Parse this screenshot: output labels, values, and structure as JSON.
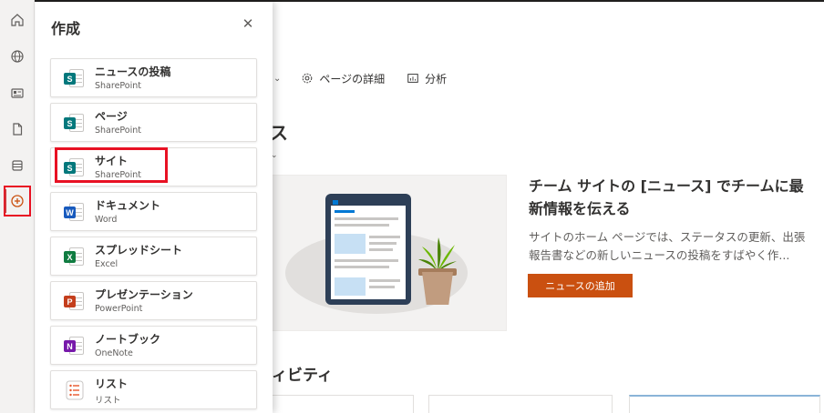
{
  "panel": {
    "title": "作成",
    "items": [
      {
        "title": "ニュースの投稿",
        "subtitle": "SharePoint",
        "app": "sharepoint",
        "letter": "S",
        "color": "#03787c"
      },
      {
        "title": "ページ",
        "subtitle": "SharePoint",
        "app": "sharepoint",
        "letter": "S",
        "color": "#03787c"
      },
      {
        "title": "サイト",
        "subtitle": "SharePoint",
        "app": "sharepoint",
        "letter": "S",
        "color": "#03787c"
      },
      {
        "title": "ドキュメント",
        "subtitle": "Word",
        "app": "word",
        "letter": "W",
        "color": "#185abd"
      },
      {
        "title": "スプレッドシート",
        "subtitle": "Excel",
        "app": "excel",
        "letter": "X",
        "color": "#107c41"
      },
      {
        "title": "プレゼンテーション",
        "subtitle": "PowerPoint",
        "app": "powerpoint",
        "letter": "P",
        "color": "#c43e1c"
      },
      {
        "title": "ノートブック",
        "subtitle": "OneNote",
        "app": "onenote",
        "letter": "N",
        "color": "#7719aa"
      },
      {
        "title": "リスト",
        "subtitle": "リスト",
        "app": "lists",
        "letter": "",
        "color": "#e8562b"
      }
    ]
  },
  "rail": {
    "items": [
      "home-icon",
      "globe-icon",
      "news-icon",
      "file-icon",
      "database-icon",
      "add-circle-icon"
    ],
    "active": "add-circle-icon"
  },
  "commandbar": {
    "page_details": "ページの詳細",
    "analytics": "分析"
  },
  "news": {
    "title_fragment": "ス",
    "promo_title": "チーム サイトの [ニュース] でチームに最新情報を伝える",
    "promo_desc": "サイトのホーム ページでは、ステータスの更新、出張報告書などの新しいニュースの投稿をすばやく作...",
    "add_button": "ニュースの追加"
  },
  "activity": {
    "title_fragment": "ィビティ"
  },
  "colors": {
    "accent_orange": "#ca5010",
    "highlight_red": "#e81123"
  }
}
